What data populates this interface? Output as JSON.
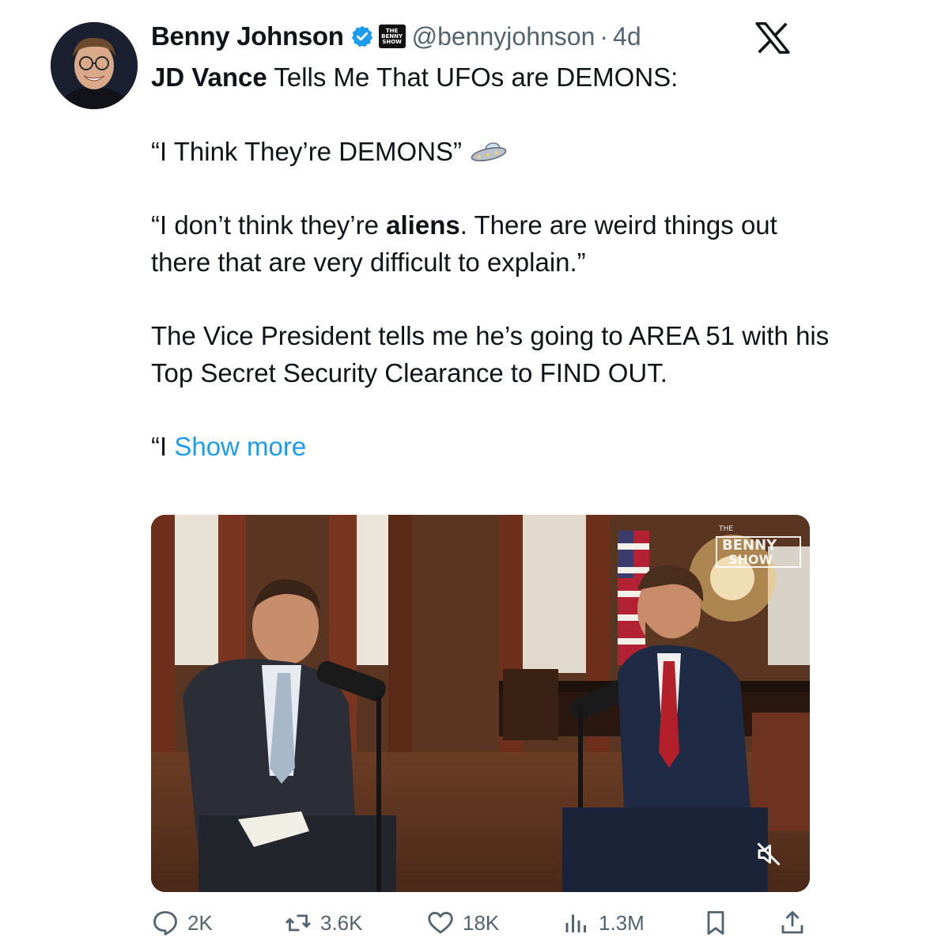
{
  "author": {
    "display_name": "Benny Johnson",
    "handle": "@bennyjohnson",
    "separator": "·",
    "timestamp": "4d",
    "affiliation_badge": [
      "THE",
      "BENNY",
      "SHOW"
    ],
    "verified_color": "#1d9bf0"
  },
  "tweet": {
    "line1_bold": "JD Vance",
    "line1_rest": " Tells Me That UFOs are DEMONS:",
    "quote1": "“I Think They’re DEMONS”",
    "quote1_emoji": "flying-saucer",
    "quote2_start": "“I don’t think they’re ",
    "quote2_bold": "aliens",
    "quote2_end": ". There are weird things out there that are very difficult to explain.”",
    "paragraph3": "The Vice President tells me he’s going to AREA 51 with his Top Secret Security Clearance to FIND OUT.",
    "truncated_start": "“I ",
    "show_more": "Show more"
  },
  "media": {
    "watermark": [
      "THE",
      "BENNY",
      "SHOW"
    ],
    "mute_icon": "speaker-muted-icon"
  },
  "actions": {
    "replies": "2K",
    "reposts": "3.6K",
    "likes": "18K",
    "views": "1.3M",
    "bookmark_icon": "bookmark-icon",
    "share_icon": "share-icon"
  },
  "colors": {
    "text": "#0f1419",
    "secondary": "#536471",
    "link": "#1d9bf0"
  }
}
